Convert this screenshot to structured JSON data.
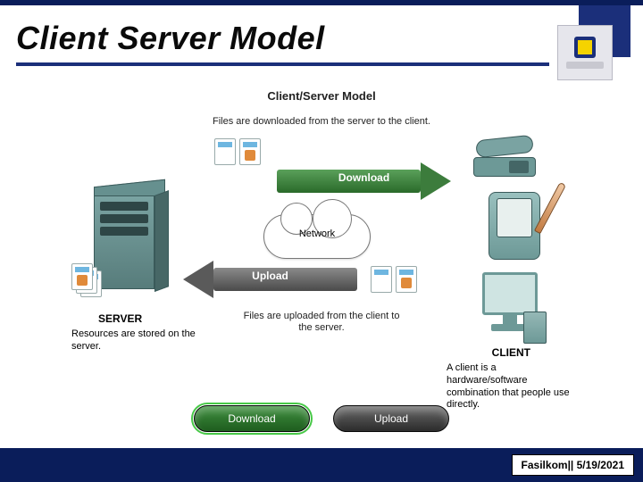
{
  "slide": {
    "title": "Client Server Model"
  },
  "diagram": {
    "heading": "Client/Server Model",
    "download_caption": "Files are downloaded from the server to the client.",
    "upload_caption": "Files are uploaded from the client to\nthe server.",
    "download_arrow_label": "Download",
    "upload_arrow_label": "Upload",
    "network_label": "Network",
    "server_label": "SERVER",
    "server_description": "Resources are stored on the server.",
    "client_label": "CLIENT",
    "client_description": "A client is a hardware/software combination that people use directly."
  },
  "buttons": {
    "download": "Download",
    "upload": "Upload"
  },
  "footer": {
    "text": "Fasilkom|| 5/19/2021"
  }
}
